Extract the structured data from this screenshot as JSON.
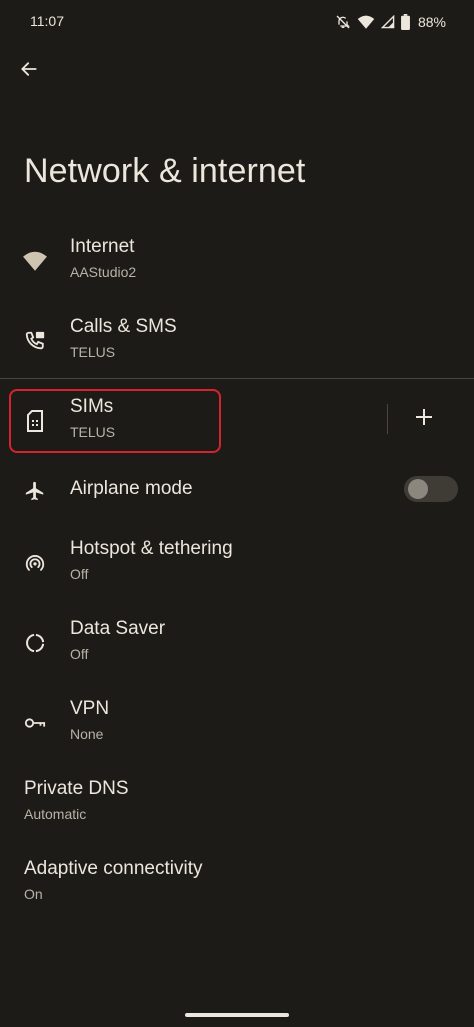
{
  "status_bar": {
    "time": "11:07",
    "battery": "88%"
  },
  "page": {
    "title": "Network & internet"
  },
  "items": [
    {
      "title": "Internet",
      "subtitle": "AAStudio2"
    },
    {
      "title": "Calls & SMS",
      "subtitle": "TELUS"
    },
    {
      "title": "SIMs",
      "subtitle": "TELUS"
    },
    {
      "title": "Airplane mode",
      "subtitle": ""
    },
    {
      "title": "Hotspot & tethering",
      "subtitle": "Off"
    },
    {
      "title": "Data Saver",
      "subtitle": "Off"
    },
    {
      "title": "VPN",
      "subtitle": "None"
    },
    {
      "title": "Private DNS",
      "subtitle": "Automatic"
    },
    {
      "title": "Adaptive connectivity",
      "subtitle": "On"
    }
  ],
  "airplane_mode": {
    "enabled": false
  },
  "colors": {
    "background": "#1c1b17",
    "text_primary": "#ece6dc",
    "text_secondary": "#b9b2a6",
    "highlight": "#d6232f"
  }
}
